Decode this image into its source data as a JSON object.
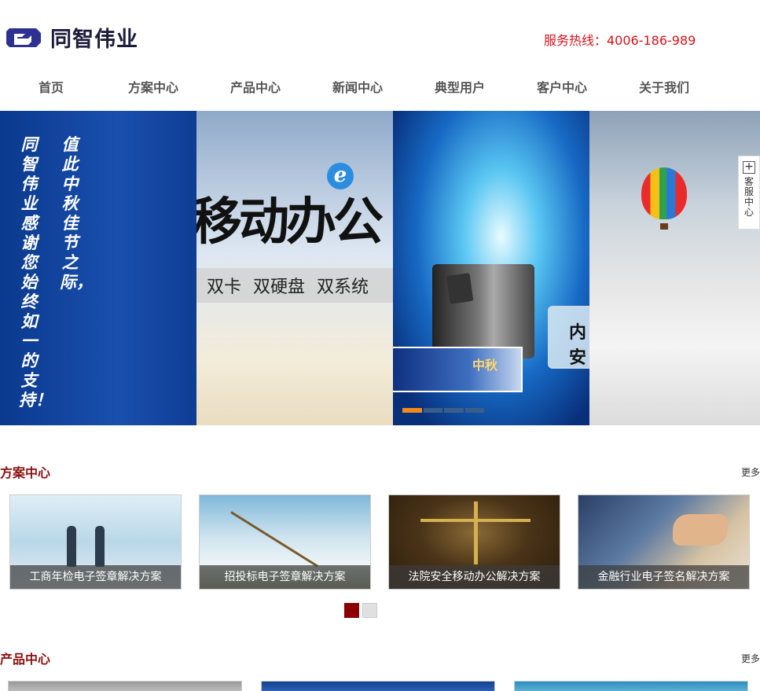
{
  "brand": {
    "name": "同智伟业",
    "logo_icon": "tz-logo-icon",
    "logo_color": "#2e3192"
  },
  "hotline": "服务热线：4006-186-989",
  "nav": [
    "首页",
    "方案中心",
    "产品中心",
    "新闻中心",
    "典型用户",
    "客户中心",
    "关于我们"
  ],
  "banner": {
    "panel1": {
      "col_a": "同智伟业感谢您始终如一的支持！",
      "col_b": "值此中秋佳节之际，"
    },
    "panel2": {
      "title": "移动办公",
      "features": [
        "双卡",
        "双硬盘",
        "双系统"
      ]
    },
    "panel3": {
      "side_lines": [
        "内",
        "安"
      ],
      "thumb_text": "中秋"
    },
    "slider_segments": 4,
    "slider_active_index": 0
  },
  "kefu": {
    "icon": "plus-icon",
    "label": "客服中心"
  },
  "solutions": {
    "title": "方案中心",
    "more": "更多",
    "items": [
      "工商年检电子签章解决方案",
      "招投标电子签章解决方案",
      "法院安全移动办公解决方案",
      "金融行业电子签名解决方案"
    ],
    "pages": 2,
    "active_page": 1
  },
  "products": {
    "title": "产品中心",
    "more": "更多"
  },
  "colors": {
    "accent": "#8b1010",
    "hotline": "#d8101a"
  }
}
